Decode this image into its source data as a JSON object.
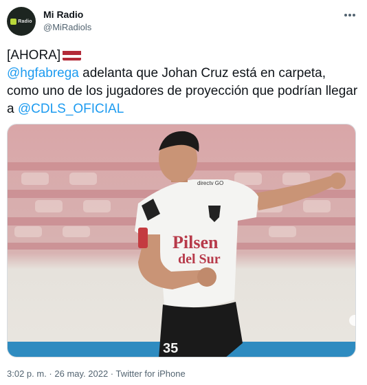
{
  "account": {
    "name": "Mi Radio",
    "handle": "@MiRadiols",
    "avatar_text": "Radio",
    "avatar_icon": "radio-logo-icon"
  },
  "menu": {
    "icon": "more-options-icon"
  },
  "tweet": {
    "prefix": "[AHORA]",
    "flag_icon": "flag-icon",
    "mention1": "@hgfabrega",
    "text1": " adelanta que Johan Cruz está en carpeta, como uno de los jugadores de proyección que podrían llegar a ",
    "mention2": "@CDLS_OFICIAL"
  },
  "media": {
    "jersey_sponsor_line1": "Pilsen",
    "jersey_sponsor_line2": "del Sur",
    "jersey_number": "35",
    "sleeve_brand": "directv GO"
  },
  "footer": {
    "time": "3:02 p. m.",
    "sep1": " · ",
    "date": "26 may. 2022",
    "sep2": " · ",
    "source": "Twitter for iPhone"
  },
  "colors": {
    "accent": "#1d9bf0",
    "text": "#0f1419",
    "muted": "#536471"
  }
}
